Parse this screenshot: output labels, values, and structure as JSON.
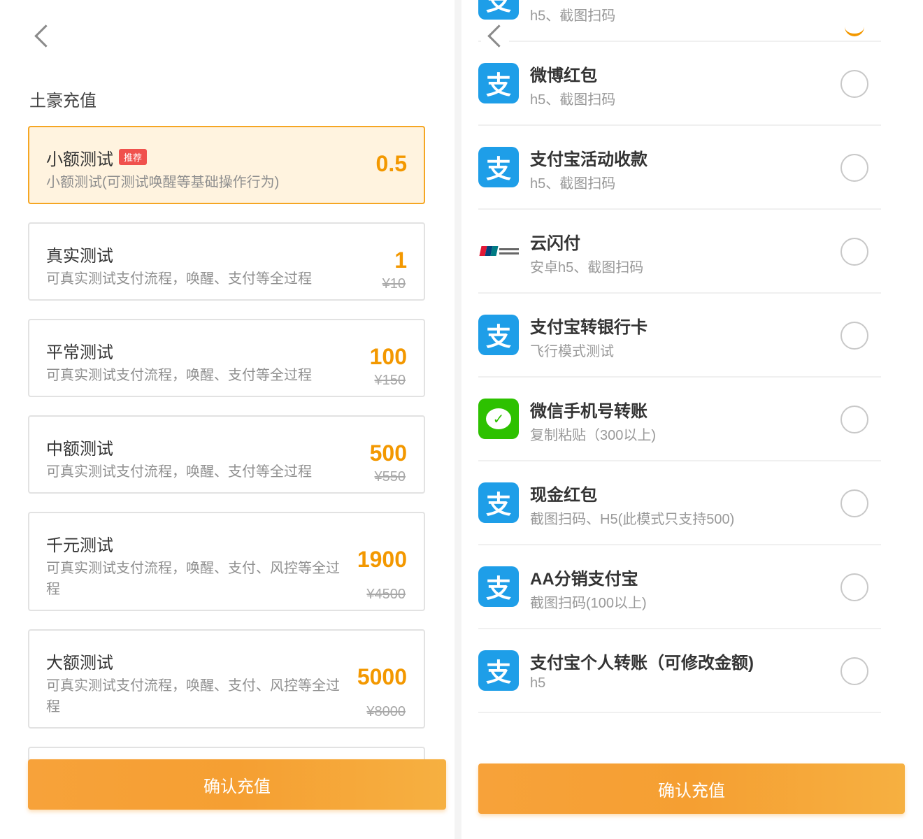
{
  "left": {
    "section_title": "土豪充值",
    "plans": [
      {
        "name": "小额测试",
        "badge": "推荐",
        "desc": "小额测试(可测试唤醒等基础操作行为)",
        "price": "0.5",
        "old_price": "",
        "selected": true
      },
      {
        "name": "真实测试",
        "badge": "",
        "desc": "可真实测试支付流程，唤醒、支付等全过程",
        "price": "1",
        "old_price": "¥10",
        "selected": false
      },
      {
        "name": "平常测试",
        "badge": "",
        "desc": "可真实测试支付流程，唤醒、支付等全过程",
        "price": "100",
        "old_price": "¥150",
        "selected": false
      },
      {
        "name": "中额测试",
        "badge": "",
        "desc": "可真实测试支付流程，唤醒、支付等全过程",
        "price": "500",
        "old_price": "¥550",
        "selected": false
      },
      {
        "name": "千元测试",
        "badge": "",
        "desc": "可真实测试支付流程，唤醒、支付、风控等全过程",
        "price": "1900",
        "old_price": "¥4500",
        "selected": false
      },
      {
        "name": "大额测试",
        "badge": "",
        "desc": "可真实测试支付流程，唤醒、支付、风控等全过程",
        "price": "5000",
        "old_price": "¥8000",
        "selected": false
      }
    ],
    "confirm_label": "确认充值"
  },
  "right": {
    "methods": [
      {
        "icon": "alipay-icon",
        "name": "",
        "desc": "h5、截图扫码"
      },
      {
        "icon": "alipay-icon",
        "name": "微博红包",
        "desc": "h5、截图扫码"
      },
      {
        "icon": "alipay-icon",
        "name": "支付宝活动收款",
        "desc": "h5、截图扫码"
      },
      {
        "icon": "unionpay-icon",
        "name": "云闪付",
        "desc": "安卓h5、截图扫码"
      },
      {
        "icon": "alipay-icon",
        "name": "支付宝转银行卡",
        "desc": "飞行模式测试"
      },
      {
        "icon": "wechat-icon",
        "name": "微信手机号转账",
        "desc": "复制粘贴（300以上)"
      },
      {
        "icon": "alipay-icon",
        "name": "现金红包",
        "desc": "截图扫码、H5(此模式只支持500)"
      },
      {
        "icon": "alipay-icon",
        "name": "AA分销支付宝",
        "desc": "截图扫码(100以上)"
      },
      {
        "icon": "alipay-icon",
        "name": "支付宝个人转账（可修改金额)",
        "desc": "h5"
      }
    ],
    "confirm_label": "确认充值"
  },
  "icons": {
    "alipay_glyph": "支",
    "wechat_glyph": "✓"
  },
  "colors": {
    "accent": "#f39800",
    "selected_bg": "#fff3df",
    "alipay": "#1e9ee8",
    "wechat": "#2dc100"
  }
}
